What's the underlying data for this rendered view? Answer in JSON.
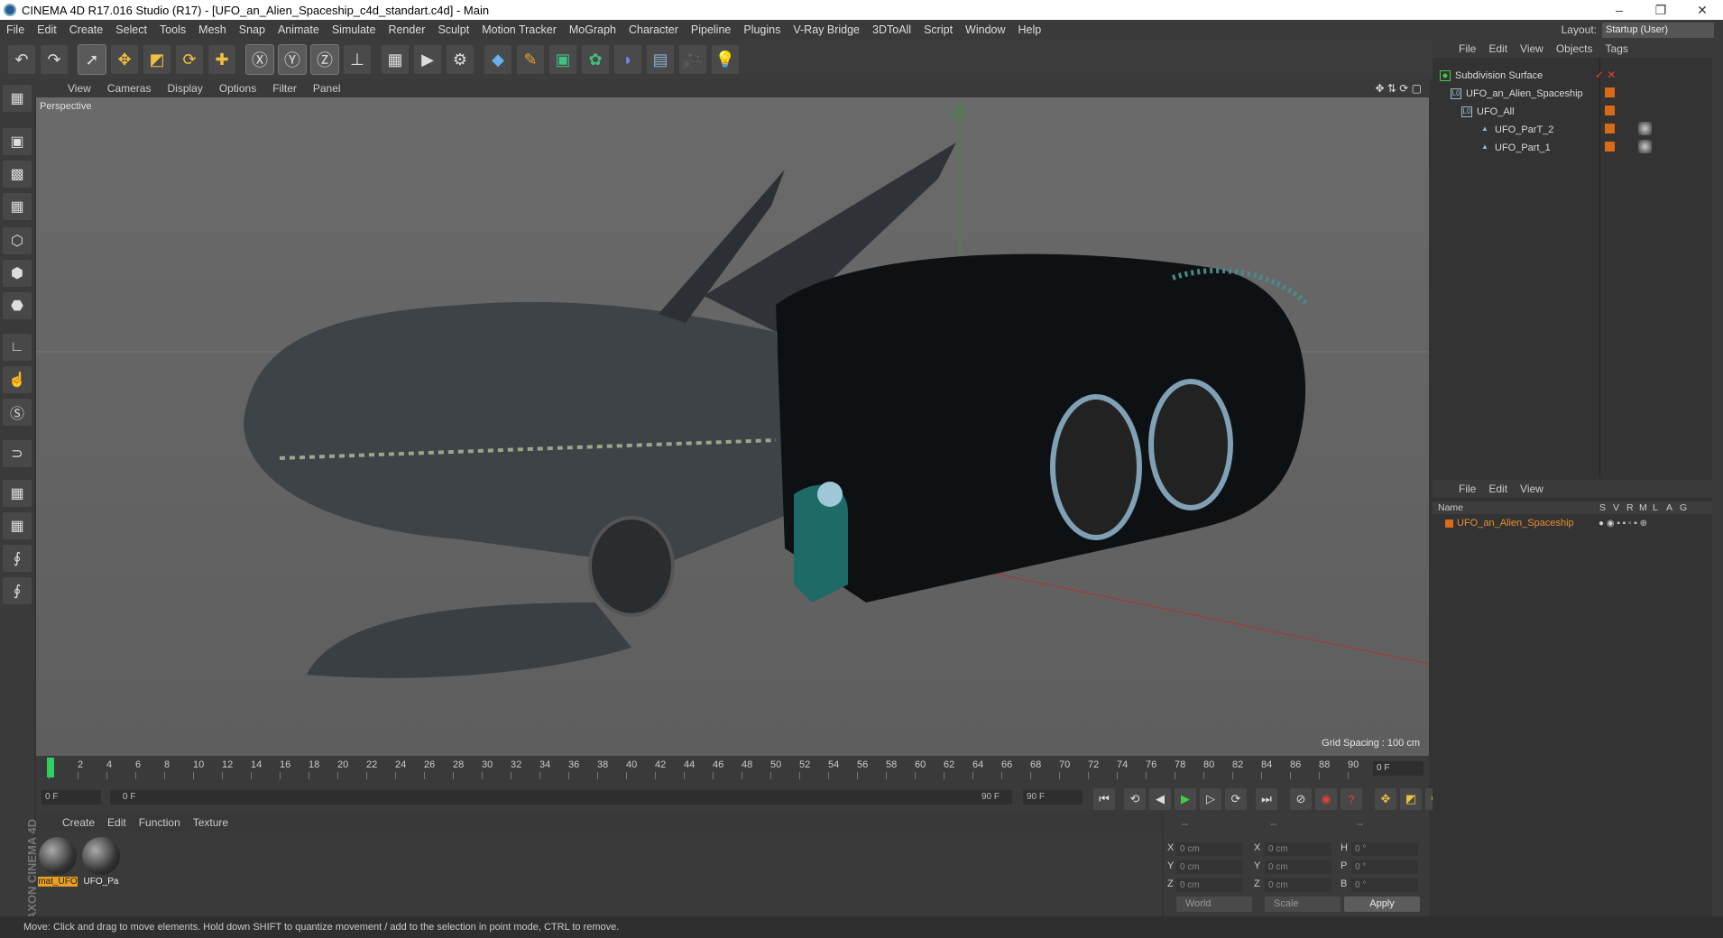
{
  "window": {
    "title": "CINEMA 4D R17.016 Studio (R17) - [UFO_an_Alien_Spaceship_c4d_standart.c4d] - Main",
    "buttons": [
      "–",
      "❐",
      "✕"
    ]
  },
  "menubar": {
    "items": [
      "File",
      "Edit",
      "Create",
      "Select",
      "Tools",
      "Mesh",
      "Snap",
      "Animate",
      "Simulate",
      "Render",
      "Sculpt",
      "Motion Tracker",
      "MoGraph",
      "Character",
      "Pipeline",
      "Plugins",
      "V-Ray Bridge",
      "3DToAll",
      "Script",
      "Window",
      "Help"
    ],
    "layout_label": "Layout:",
    "layout_value": "Startup (User)"
  },
  "toolbar": {
    "icons": [
      "undo-icon",
      "redo-icon",
      "select-arrow-icon",
      "move-icon",
      "scale-icon",
      "rotate-icon",
      "live-select-icon",
      "x-axis-icon",
      "y-axis-icon",
      "z-axis-icon",
      "coord-system-icon",
      "render-view-icon",
      "render-picture-viewer-icon",
      "render-settings-icon",
      "cube-icon",
      "pen-icon",
      "subdivision-icon",
      "cloner-icon",
      "deformer-icon",
      "floor-icon",
      "camera-icon",
      "light-icon"
    ]
  },
  "viewport": {
    "menu": [
      "View",
      "Cameras",
      "Display",
      "Options",
      "Filter",
      "Panel"
    ],
    "camera_label": "Perspective",
    "grid_spacing": "Grid Spacing : 100 cm"
  },
  "timeline": {
    "ticks": [
      "0",
      "2",
      "4",
      "6",
      "8",
      "10",
      "12",
      "14",
      "16",
      "18",
      "20",
      "22",
      "24",
      "26",
      "28",
      "30",
      "32",
      "34",
      "36",
      "38",
      "40",
      "42",
      "44",
      "46",
      "48",
      "50",
      "52",
      "54",
      "56",
      "58",
      "60",
      "62",
      "64",
      "66",
      "68",
      "70",
      "72",
      "74",
      "76",
      "78",
      "80",
      "82",
      "84",
      "86",
      "88",
      "90"
    ],
    "current_frame": "0 F",
    "start_field": "0 F",
    "range_start": "0 F",
    "range_end": "90 F",
    "end_field": "90 F"
  },
  "materials": {
    "menu": [
      "Create",
      "Edit",
      "Function",
      "Texture"
    ],
    "items": [
      {
        "label": "mat_UFO",
        "selected": true
      },
      {
        "label": "UFO_Pa",
        "selected": false
      }
    ],
    "brand": "MAXON CINEMA 4D"
  },
  "coordinates": {
    "headers": [
      "--",
      "--",
      "--"
    ],
    "rows": [
      {
        "a1": "X",
        "v1": "0 cm",
        "a2": "X",
        "v2": "0 cm",
        "a3": "H",
        "v3": "0 °"
      },
      {
        "a1": "Y",
        "v1": "0 cm",
        "a2": "Y",
        "v2": "0 cm",
        "a3": "P",
        "v3": "0 °"
      },
      {
        "a1": "Z",
        "v1": "0 cm",
        "a2": "Z",
        "v2": "0 cm",
        "a3": "B",
        "v3": "0 °"
      }
    ],
    "mode1": "World",
    "mode2": "Scale",
    "apply": "Apply"
  },
  "objects": {
    "menu": [
      "File",
      "Edit",
      "View",
      "Objects",
      "Tags"
    ],
    "tree": [
      {
        "name": "Subdivision Surface",
        "indent": 0
      },
      {
        "name": "UFO_an_Alien_Spaceship",
        "indent": 1
      },
      {
        "name": "UFO_All",
        "indent": 2
      },
      {
        "name": "UFO_ParT_2",
        "indent": 3
      },
      {
        "name": "UFO_Part_1",
        "indent": 3
      }
    ]
  },
  "attributes": {
    "menu": [
      "File",
      "Edit",
      "View"
    ],
    "header_name": "Name",
    "header_cols": [
      "S",
      "V",
      "R",
      "M",
      "L",
      "A",
      "G"
    ],
    "row_name": "UFO_an_Alien_Spaceship"
  },
  "status": {
    "text": "Move: Click and drag to move elements. Hold down SHIFT to quantize movement / add to the selection in point mode, CTRL to remove."
  },
  "colors": {
    "accent_orange": "#e8a020",
    "object_tag_orange": "#d86a18",
    "ui_dark": "#333333"
  }
}
